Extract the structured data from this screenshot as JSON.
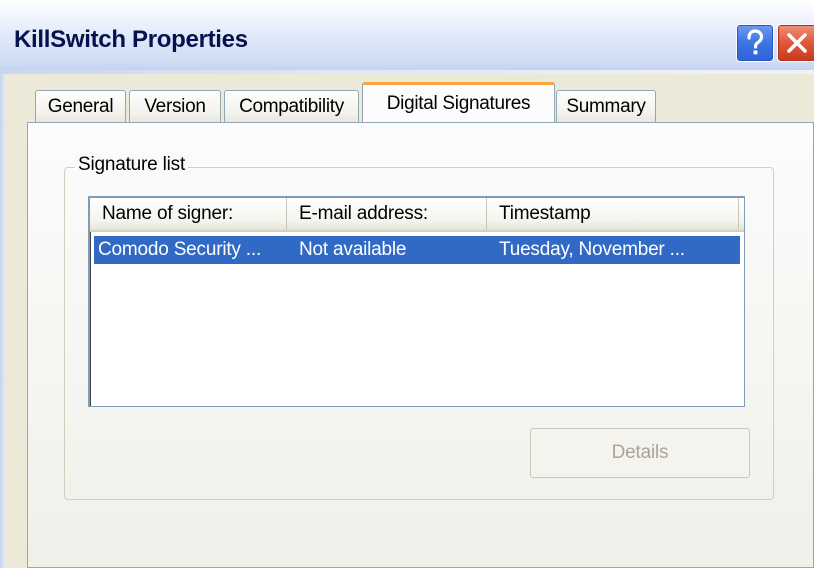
{
  "window": {
    "title": "KillSwitch Properties"
  },
  "title_buttons": {
    "help_icon": "question-mark",
    "close_icon": "x-mark"
  },
  "tabs": [
    {
      "label": "General",
      "active": false
    },
    {
      "label": "Version",
      "active": false
    },
    {
      "label": "Compatibility",
      "active": false
    },
    {
      "label": "Digital Signatures",
      "active": true
    },
    {
      "label": "Summary",
      "active": false
    }
  ],
  "signature_list": {
    "group_label": "Signature list",
    "columns": [
      "Name of signer:",
      "E-mail address:",
      "Timestamp"
    ],
    "rows": [
      {
        "name": "Comodo Security ...",
        "email": "Not available",
        "timestamp": "Tuesday, November ...",
        "selected": true
      }
    ]
  },
  "details_button": {
    "label": "Details",
    "enabled": false
  },
  "colors": {
    "title_text": "#06124f",
    "selection": "#316ac5",
    "active_tab_accent": "#f9a53b",
    "dialog_face": "#ece9d8"
  }
}
